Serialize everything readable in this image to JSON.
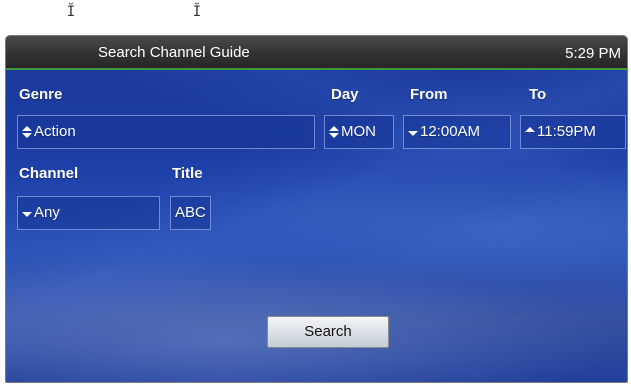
{
  "top_cursors": [
    "Ĭ",
    "Ĭ"
  ],
  "window": {
    "title": "Search Channel Guide",
    "clock": "5:29 PM",
    "accent_color": "#3c9a3c"
  },
  "form": {
    "genre": {
      "label": "Genre",
      "value": "Action",
      "icon": "up-down-arrows-icon"
    },
    "day": {
      "label": "Day",
      "value": "MON",
      "icon": "up-down-arrows-icon"
    },
    "from": {
      "label": "From",
      "value": "12:00AM",
      "icon": "down-arrow-icon"
    },
    "to": {
      "label": "To",
      "value": "11:59PM",
      "icon": "up-arrow-icon"
    },
    "channel": {
      "label": "Channel",
      "value": "Any",
      "icon": "down-arrow-icon"
    },
    "title": {
      "label": "Title",
      "value": "ABC"
    }
  },
  "search_button": {
    "label": "Search"
  }
}
